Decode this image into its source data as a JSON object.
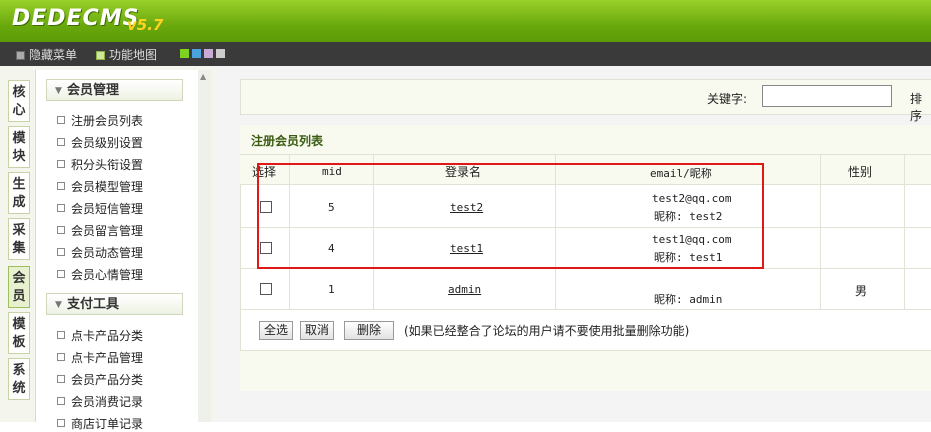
{
  "header": {
    "logo": "DEDECMS",
    "version": "v5.7"
  },
  "menubar": {
    "hide_menu": "隐藏菜单",
    "func_map": "功能地图"
  },
  "skin_colors": [
    "#7ed321",
    "#4aa3df",
    "#c9a9d6",
    "#cccccc"
  ],
  "side_tabs": [
    "核心",
    "模块",
    "生成",
    "采集",
    "会员",
    "模板",
    "系统"
  ],
  "groups": {
    "member": "会员管理",
    "pay": "支付工具"
  },
  "member_items": [
    "注册会员列表",
    "会员级别设置",
    "积分头衔设置",
    "会员模型管理",
    "会员短信管理",
    "会员留言管理",
    "会员动态管理",
    "会员心情管理"
  ],
  "pay_items": [
    "点卡产品分类",
    "点卡产品管理",
    "会员产品分类",
    "会员消费记录",
    "商店订单记录"
  ],
  "search": {
    "keyword_label": "关键字:",
    "keyword_value": "",
    "sort_label": "排序"
  },
  "list": {
    "title": "注册会员列表",
    "columns": {
      "select": "选择",
      "mid": "mid",
      "login": "登录名",
      "email": "email/昵称",
      "gender": "性别"
    },
    "rows": [
      {
        "mid": "5",
        "login": "test2",
        "email": "test2@qq.com",
        "nick": "昵称: test2",
        "gender": ""
      },
      {
        "mid": "4",
        "login": "test1",
        "email": "test1@qq.com",
        "nick": "昵称: test1",
        "gender": ""
      },
      {
        "mid": "1",
        "login": "admin",
        "email": "",
        "nick": "昵称: admin",
        "gender": "男"
      }
    ]
  },
  "actions": {
    "select_all": "全选",
    "cancel": "取消",
    "delete": "删除",
    "note": "(如果已经整合了论坛的用户请不要使用批量删除功能)"
  }
}
